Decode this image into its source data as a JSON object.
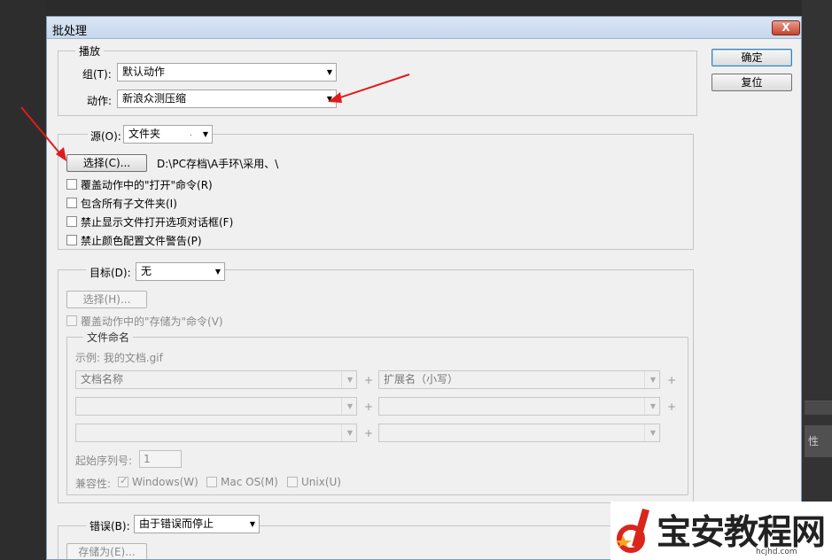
{
  "dialog": {
    "title": "批处理",
    "close": "X"
  },
  "buttons": {
    "ok": "确定",
    "reset": "复位"
  },
  "play": {
    "group_label": "播放",
    "set_label": "组(T):",
    "set_value": "默认动作",
    "action_label": "动作:",
    "action_value": "新浪众测压缩"
  },
  "source": {
    "label": "源(O):",
    "value": "文件夹",
    "choose_button": "选择(C)...",
    "path": "D:\\PC存档\\A手环\\采用、\\",
    "options": [
      {
        "label": "覆盖动作中的\"打开\"命令(R)",
        "checked": false
      },
      {
        "label": "包含所有子文件夹(I)",
        "checked": false
      },
      {
        "label": "禁止显示文件打开选项对话框(F)",
        "checked": false
      },
      {
        "label": "禁止颜色配置文件警告(P)",
        "checked": false
      }
    ]
  },
  "destination": {
    "label": "目标(D):",
    "value": "无",
    "choose_button": "选择(H)...",
    "override_save": "覆盖动作中的\"存储为\"命令(V)",
    "naming": {
      "group_label": "文件命名",
      "example": "示例: 我的文档.gif",
      "fields": [
        "文档名称",
        "扩展名（小写）",
        "",
        "",
        "",
        ""
      ],
      "plus": "+",
      "serial_label": "起始序列号:",
      "serial_value": "1",
      "compat_label": "兼容性:",
      "compat_options": [
        {
          "label": "Windows(W)",
          "checked": true
        },
        {
          "label": "Mac OS(M)",
          "checked": false
        },
        {
          "label": "Unix(U)",
          "checked": false
        }
      ]
    }
  },
  "errors": {
    "label": "错误(B):",
    "value": "由于错误而停止",
    "save_as_button": "存储为(E)..."
  },
  "background": {
    "panel_text": "性"
  },
  "watermark": {
    "brand": "宝安教程网",
    "site": "hcjhd.com"
  },
  "colors": {
    "arrow": "#e01b1b",
    "accent": "#3c7fb1",
    "watermark_red": "#d9251c",
    "watermark_orange": "#f5a623"
  }
}
